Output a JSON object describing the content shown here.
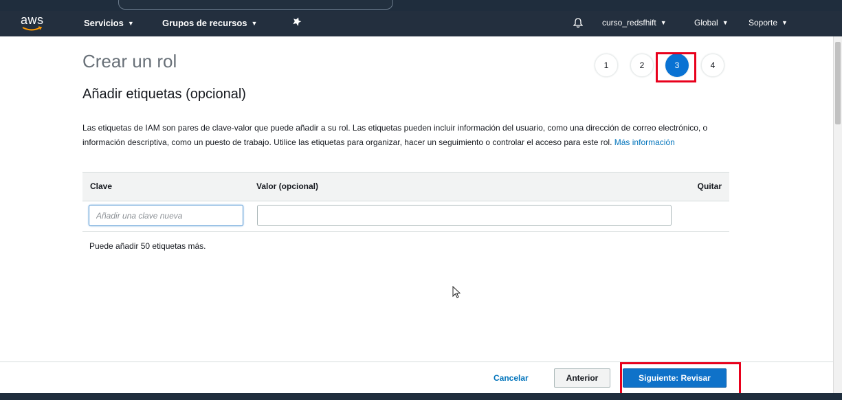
{
  "nav": {
    "logo_text": "aws",
    "services_label": "Servicios",
    "resource_groups_label": "Grupos de recursos",
    "account_label": "curso_redsfhift",
    "region_label": "Global",
    "support_label": "Soporte",
    "icons": {
      "pin": "pin-icon",
      "bell": "bell-icon",
      "caret": "chevron-down-icon"
    }
  },
  "page": {
    "title": "Crear un rol",
    "steps": [
      "1",
      "2",
      "3",
      "4"
    ],
    "active_step": "3",
    "section_title": "Añadir etiquetas (opcional)",
    "description": "Las etiquetas de IAM son pares de clave-valor que puede añadir a su rol. Las etiquetas pueden incluir información del usuario, como una dirección de correo electrónico, o información descriptiva, como un puesto de trabajo. Utilice las etiquetas para organizar, hacer un seguimiento o controlar el acceso para este rol.",
    "learn_more_link": "Más información"
  },
  "tags_table": {
    "columns": {
      "key": "Clave",
      "value": "Valor (opcional)",
      "remove": "Quitar"
    },
    "key_placeholder": "Añadir una clave nueva",
    "key_value": "",
    "value_value": "",
    "remaining_text": "Puede añadir 50 etiquetas más."
  },
  "footer": {
    "cancel_label": "Cancelar",
    "previous_label": "Anterior",
    "next_label": "Siguiente: Revisar"
  },
  "colors": {
    "navbar": "#232f3e",
    "primary": "#0f72c9",
    "link": "#0073bb",
    "highlight_box": "#e8001c"
  }
}
